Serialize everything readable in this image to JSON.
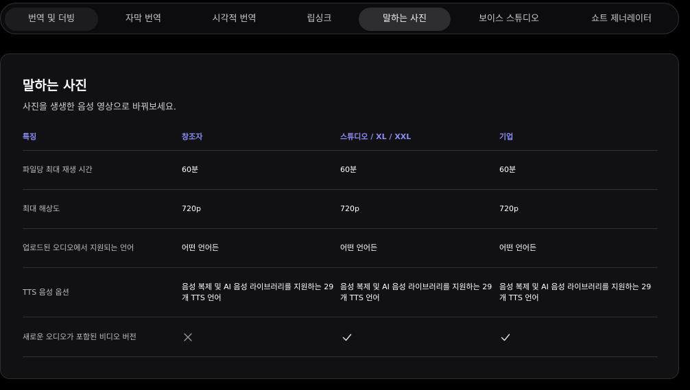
{
  "tabs": [
    {
      "label": "번역 및 더빙"
    },
    {
      "label": "자막 번역"
    },
    {
      "label": "시각적 번역"
    },
    {
      "label": "립싱크"
    },
    {
      "label": "말하는 사진"
    },
    {
      "label": "보이스 스튜디오"
    },
    {
      "label": "쇼트 제너레이터"
    }
  ],
  "active_tab": "말하는 사진",
  "card": {
    "title": "말하는 사진",
    "subtitle": "사진을 생생한 음성 영상으로 바꿔보세요."
  },
  "table": {
    "headers": [
      "특징",
      "창조자",
      "스튜디오 / XL / XXL",
      "기업"
    ],
    "rows": [
      {
        "feature": "파일당 최대 재생 시간",
        "values": [
          "60분",
          "60분",
          "60분"
        ]
      },
      {
        "feature": "최대 해상도",
        "values": [
          "720p",
          "720p",
          "720p"
        ]
      },
      {
        "feature": "업로드된 오디오에서 지원되는 언어",
        "values": [
          "어떤 언어든",
          "어떤 언어든",
          "어떤 언어든"
        ]
      },
      {
        "feature": "TTS 음성 옵션",
        "values": [
          "음성 복제 및 AI 음성 라이브러리를 지원하는 29개 TTS 언어",
          "음성 복제 및 AI 음성 라이브러리를 지원하는 29개 TTS 언어",
          "음성 복제 및 AI 음성 라이브러리를 지원하는 29개 TTS 언어"
        ]
      },
      {
        "feature": "새로운 오디오가 포함된 비디오 버전",
        "icons": [
          "x-mark-icon",
          "check-icon",
          "check-icon"
        ]
      }
    ]
  },
  "colors": {
    "header_accent": "#8b8cf6",
    "background": "#000000",
    "card": "#111114",
    "active_tab": "#2c2c31"
  }
}
